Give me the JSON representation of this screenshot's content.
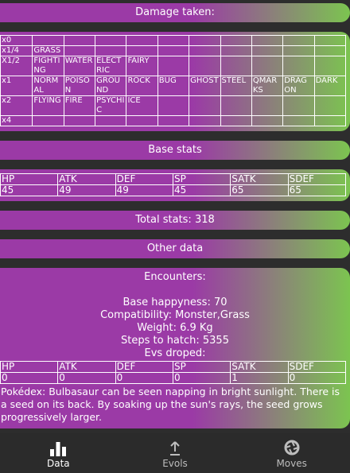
{
  "headers": {
    "damage_taken": "Damage taken:",
    "base_stats": "Base stats",
    "total_stats": "Total stats: 318",
    "other_data": "Other data"
  },
  "damage": {
    "rows": [
      {
        "mult": "x0",
        "types": [
          "",
          "",
          "",
          "",
          "",
          "",
          "",
          "",
          "",
          ""
        ]
      },
      {
        "mult": "x1/4",
        "types": [
          "GRASS",
          "",
          "",
          "",
          "",
          "",
          "",
          "",
          "",
          ""
        ]
      },
      {
        "mult": "X1/2",
        "types": [
          "FIGHTING",
          "WATER",
          "ELECTRIC",
          "FAIRY",
          "",
          "",
          "",
          "",
          "",
          ""
        ]
      },
      {
        "mult": "x1",
        "types": [
          "NORMAL",
          "POISON",
          "GROUND",
          "ROCK",
          "BUG",
          "GHOST",
          "STEEL",
          "QMARKS",
          "DRAGON",
          "DARK"
        ]
      },
      {
        "mult": "x2",
        "types": [
          "FLYING",
          "FIRE",
          "PSYCHIC",
          "ICE",
          "",
          "",
          "",
          "",
          "",
          ""
        ]
      },
      {
        "mult": "x4",
        "types": [
          "",
          "",
          "",
          "",
          "",
          "",
          "",
          "",
          "",
          ""
        ]
      }
    ]
  },
  "base_stats": {
    "labels": [
      "HP",
      "ATK",
      "DEF",
      "SP",
      "SATK",
      "SDEF"
    ],
    "values": [
      "45",
      "49",
      "49",
      "45",
      "65",
      "65"
    ]
  },
  "other": {
    "encounters": "Encounters:",
    "happiness": "Base happyness: 70",
    "compatibility": "Compatibility: Monster,Grass",
    "weight": "Weight: 6.9 Kg",
    "steps": "Steps to hatch: 5355",
    "evs_title": "Evs droped:",
    "evs_labels": [
      "HP",
      "ATK",
      "DEF",
      "SP",
      "SATK",
      "SDEF"
    ],
    "evs_values": [
      "0",
      "0",
      "0",
      "0",
      "1",
      "0"
    ],
    "pokedex": "Pokédex: Bulbasaur can be seen napping in bright sunlight. There is a seed on its back. By soaking up the sun's rays, the seed grows progressively larger."
  },
  "nav": {
    "data": "Data",
    "evols": "Evols",
    "moves": "Moves"
  }
}
